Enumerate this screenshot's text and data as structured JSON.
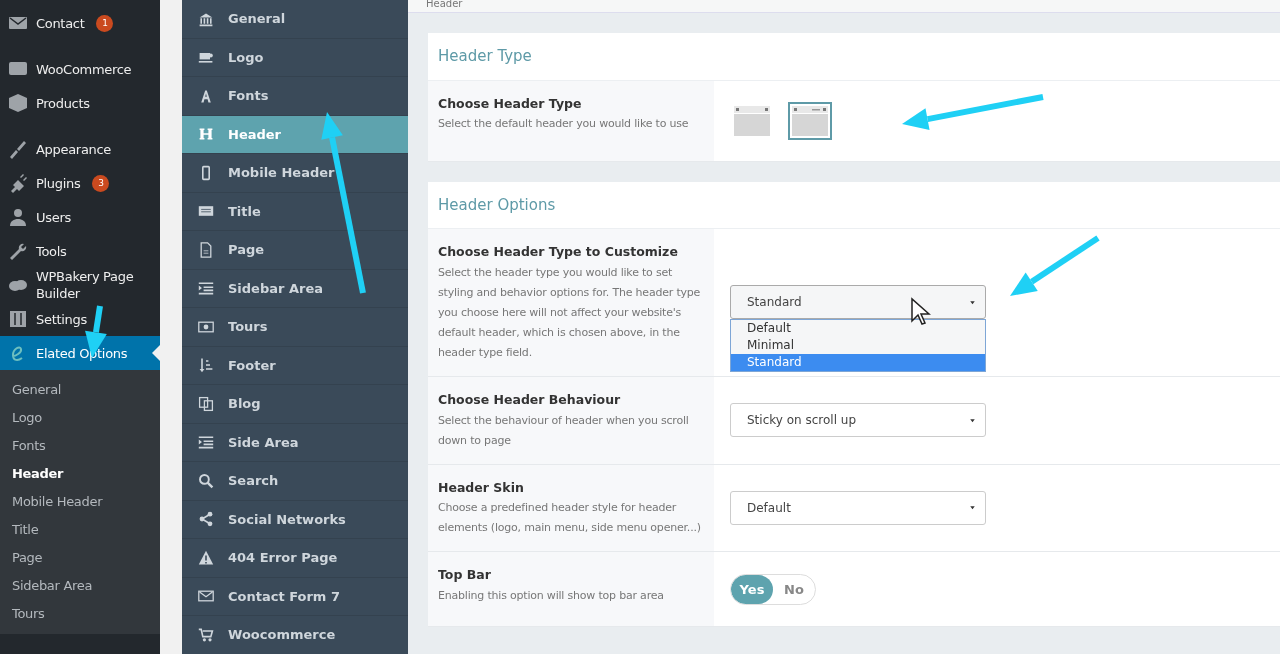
{
  "admin_menu": [
    [
      {
        "label": "Contact",
        "badge": "1",
        "selected": false
      }
    ],
    [
      {
        "label": "WooCommerce",
        "selected": false
      },
      {
        "label": "Products",
        "selected": false
      }
    ],
    [
      {
        "label": "Appearance",
        "selected": false
      },
      {
        "label": "Plugins",
        "badge": "3",
        "selected": false
      },
      {
        "label": "Users",
        "selected": false
      },
      {
        "label": "Tools",
        "selected": false
      },
      {
        "label": "WPBakery Page Builder",
        "selected": false
      },
      {
        "label": "Settings",
        "selected": false
      },
      {
        "label": "Elated Options",
        "selected": true,
        "submenu": [
          {
            "label": "General",
            "selected": false
          },
          {
            "label": "Logo",
            "selected": false
          },
          {
            "label": "Fonts",
            "selected": false
          },
          {
            "label": "Header",
            "selected": true
          },
          {
            "label": "Mobile Header",
            "selected": false
          },
          {
            "label": "Title",
            "selected": false
          },
          {
            "label": "Page",
            "selected": false
          },
          {
            "label": "Sidebar Area",
            "selected": false
          },
          {
            "label": "Tours",
            "selected": false
          }
        ]
      }
    ]
  ],
  "options_nav": [
    {
      "label": "General",
      "selected": false
    },
    {
      "label": "Logo",
      "selected": false
    },
    {
      "label": "Fonts",
      "selected": false
    },
    {
      "label": "Header",
      "selected": true
    },
    {
      "label": "Mobile Header",
      "selected": false
    },
    {
      "label": "Title",
      "selected": false
    },
    {
      "label": "Page",
      "selected": false
    },
    {
      "label": "Sidebar Area",
      "selected": false
    },
    {
      "label": "Tours",
      "selected": false
    },
    {
      "label": "Footer",
      "selected": false
    },
    {
      "label": "Blog",
      "selected": false
    },
    {
      "label": "Side Area",
      "selected": false
    },
    {
      "label": "Search",
      "selected": false
    },
    {
      "label": "Social Networks",
      "selected": false
    },
    {
      "label": "404 Error Page",
      "selected": false
    },
    {
      "label": "Contact Form 7",
      "selected": false
    },
    {
      "label": "Woocommerce",
      "selected": false
    }
  ],
  "page_title": "Header",
  "sections": [
    {
      "title": "Header Type",
      "rows": [
        {
          "kind": "image_choice",
          "label": "Choose Header Type",
          "description": "Select the default header you would like to use",
          "choices": [
            {
              "selected": false
            },
            {
              "selected": true
            }
          ]
        }
      ]
    },
    {
      "title": "Header Options",
      "rows": [
        {
          "kind": "select",
          "label": "Choose Header Type to Customize",
          "description": "Select the header type you would like to set styling and behavior options for. The header type you choose here will not affect your website's default header, which is chosen above, in the header type field.",
          "value": "Standard",
          "expanded": true,
          "options": [
            {
              "label": "Default",
              "selected": false
            },
            {
              "label": "Minimal",
              "selected": false
            },
            {
              "label": "Standard",
              "selected": true
            }
          ]
        },
        {
          "kind": "select",
          "label": "Choose Header Behaviour",
          "description": "Select the behaviour of header when you scroll down to page",
          "value": "Sticky on scroll up",
          "expanded": false
        },
        {
          "kind": "select",
          "label": "Header Skin",
          "description": "Choose a predefined header style for header elements (logo, main menu, side menu opener...)",
          "value": "Default",
          "expanded": false
        },
        {
          "kind": "toggle",
          "label": "Top Bar",
          "description": "Enabling this option will show top bar area",
          "yes": "Yes",
          "no": "No",
          "on": true
        }
      ]
    }
  ]
}
